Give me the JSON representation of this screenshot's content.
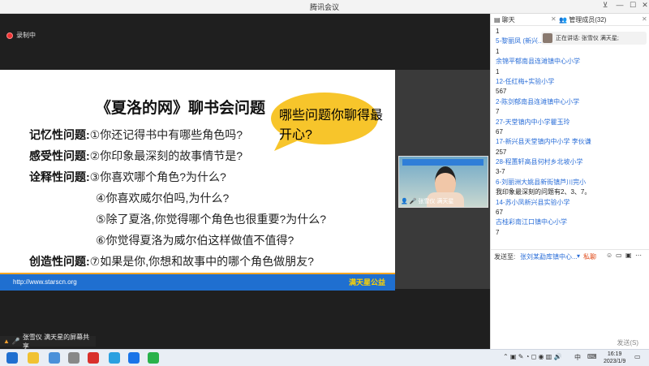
{
  "window": {
    "title": "腾讯会议"
  },
  "recording": {
    "label": "录制中"
  },
  "slide": {
    "title": "《夏洛的网》聊书会问题",
    "bubble": "哪些问题你聊得最开心?",
    "questions": [
      {
        "category": "记忆性问题:",
        "text": "①你还记得书中有哪些角色吗?"
      },
      {
        "category": "感受性问题:",
        "text": "②你印象最深刻的故事情节是?"
      },
      {
        "category": "诠释性问题:",
        "text": "③你喜欢哪个角色?为什么?"
      },
      {
        "category": "",
        "text": "④你喜欢威尔伯吗,为什么?"
      },
      {
        "category": "",
        "text": "⑤除了夏洛,你觉得哪个角色也很重要?为什么?"
      },
      {
        "category": "",
        "text": "⑥你觉得夏洛为威尔伯这样做值不值得?"
      },
      {
        "category": "创造性问题:",
        "text": "⑦如果是你,你想和故事中的哪个角色做朋友?"
      }
    ],
    "footer_url": "http://www.starscn.org",
    "footer_brand": "满天星公益"
  },
  "video": {
    "name": "张雪仪 满天星"
  },
  "share": {
    "label": "张雪仪 满天星的屏幕共享"
  },
  "chat": {
    "tab_chat": "聊天",
    "tab_members": "管理成员(32)",
    "notice": "正在讲话: 张雪仪 满天星;",
    "messages": [
      {
        "type": "txt",
        "text": "1"
      },
      {
        "type": "link",
        "text": "5-黎丽凤 (新兴..."
      },
      {
        "type": "txt",
        "text": "1"
      },
      {
        "type": "link",
        "text": "余锦平郁南县连滩镇中心小学"
      },
      {
        "type": "txt",
        "text": "1"
      },
      {
        "type": "link",
        "text": "12-任红梅+实验小学"
      },
      {
        "type": "txt",
        "text": "567"
      },
      {
        "type": "link",
        "text": "2-陈剑郁南县连滩镇中心小学"
      },
      {
        "type": "txt",
        "text": "7"
      },
      {
        "type": "link",
        "text": "27-天堂镇内中小学瞿玉玲"
      },
      {
        "type": "txt",
        "text": "67"
      },
      {
        "type": "link",
        "text": "17-新兴县天堂镇内中小学 李伙谦"
      },
      {
        "type": "txt",
        "text": "257"
      },
      {
        "type": "link",
        "text": "28-程蕙轩高县何村乡北坡小学"
      },
      {
        "type": "txt",
        "text": "3-7"
      },
      {
        "type": "link",
        "text": "6-刘丽洲大姚县新街镇芦川完小"
      },
      {
        "type": "txt",
        "text": "我印象最深刻的问题有2、3、7。"
      },
      {
        "type": "link",
        "text": "14-苏小凤新兴县实验小学"
      },
      {
        "type": "txt",
        "text": "67"
      },
      {
        "type": "link",
        "text": "古桂彩南江口镇中心小学"
      },
      {
        "type": "txt",
        "text": "7"
      }
    ],
    "send_to_label": "发送至:",
    "send_to_value": "张刘某勐库镇中心...",
    "private_label": "私聊",
    "send_button": "发送(S)"
  },
  "taskbar": {
    "ime": "中",
    "time": "16:19",
    "date": "2023/1/9"
  }
}
